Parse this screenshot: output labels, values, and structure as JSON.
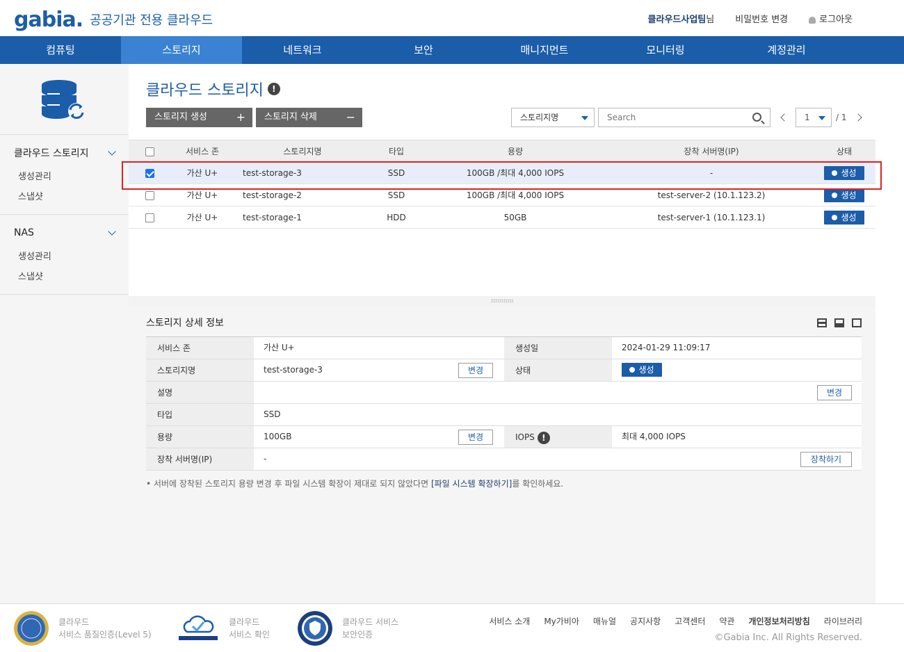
{
  "header": {
    "logo_mark": "gabia",
    "logo_sub": "공공기관 전용 클라우드",
    "user_name": "클라우드사업팀",
    "user_suffix": "님",
    "change_password": "비밀번호 변경",
    "logout": "로그아웃"
  },
  "nav": [
    {
      "label": "컴퓨팅"
    },
    {
      "label": "스토리지"
    },
    {
      "label": "네트워크"
    },
    {
      "label": "보안"
    },
    {
      "label": "매니지먼트"
    },
    {
      "label": "모니터링"
    },
    {
      "label": "계정관리"
    }
  ],
  "sidebar": {
    "groups": [
      {
        "label": "클라우드 스토리지",
        "items": [
          "생성관리",
          "스냅샷"
        ]
      },
      {
        "label": "NAS",
        "items": [
          "생성관리",
          "스냅샷"
        ]
      }
    ]
  },
  "page": {
    "title": "클라우드 스토리지",
    "create_label": "스토리지 생성",
    "delete_label": "스토리지 삭제",
    "filter_value": "스토리지명",
    "search_placeholder": "Search",
    "page_current": "1",
    "page_total": "/ 1"
  },
  "table": {
    "headers": [
      "서비스 존",
      "스토리지명",
      "타입",
      "용량",
      "장착 서버명(IP)",
      "상태"
    ],
    "rows": [
      {
        "zone": "가산 U+",
        "name": "test-storage-3",
        "type": "SSD",
        "capacity": "100GB /최대 4,000 IOPS",
        "server": "-",
        "status": "생성",
        "checked": true
      },
      {
        "zone": "가산 U+",
        "name": "test-storage-2",
        "type": "SSD",
        "capacity": "100GB /최대 4,000 IOPS",
        "server": "test-server-2 (10.1.123.2)",
        "status": "생성",
        "checked": false
      },
      {
        "zone": "가산 U+",
        "name": "test-storage-1",
        "type": "HDD",
        "capacity": "50GB",
        "server": "test-server-1 (10.1.123.1)",
        "status": "생성",
        "checked": false
      }
    ]
  },
  "detail": {
    "title": "스토리지 상세 정보",
    "zone_label": "서비스 존",
    "zone": "가산 U+",
    "created_label": "생성일",
    "created": "2024-01-29 11:09:17",
    "name_label": "스토리지명",
    "name": "test-storage-3",
    "status_label": "상태",
    "status": "생성",
    "desc_label": "설명",
    "desc": "",
    "type_label": "타입",
    "type": "SSD",
    "capacity_label": "용량",
    "capacity": "100GB",
    "iops_label": "IOPS",
    "iops": "최대 4,000 IOPS",
    "server_label": "장착 서버명(IP)",
    "server": "-",
    "change_label": "변경",
    "attach_label": "장착하기",
    "note_pre": "• 서버에 장착된 스토리지 용량 변경 후 파일 시스템 확장이 제대로 되지 않았다면 ",
    "note_link": "[파일 시스템 확장하기]",
    "note_post": "를 확인하세요."
  },
  "footer": {
    "cert1_line1": "클라우드",
    "cert1_line2": "서비스 품질인증(Level 5)",
    "cert2_line1": "클라우드",
    "cert2_line2": "서비스 확인",
    "cert3_line1": "클라우드 서비스",
    "cert3_line2": "보안인증",
    "links": [
      "서비스 소개",
      "My가비아",
      "매뉴얼",
      "공지사항",
      "고객센터",
      "약관",
      "개인정보처리방침",
      "라이브러리"
    ],
    "copyright": "©Gabia Inc. All Rights Reserved."
  },
  "colors": {
    "brand": "#1b5da9",
    "nav_active": "#3b83d2",
    "highlight": "#e02020"
  }
}
